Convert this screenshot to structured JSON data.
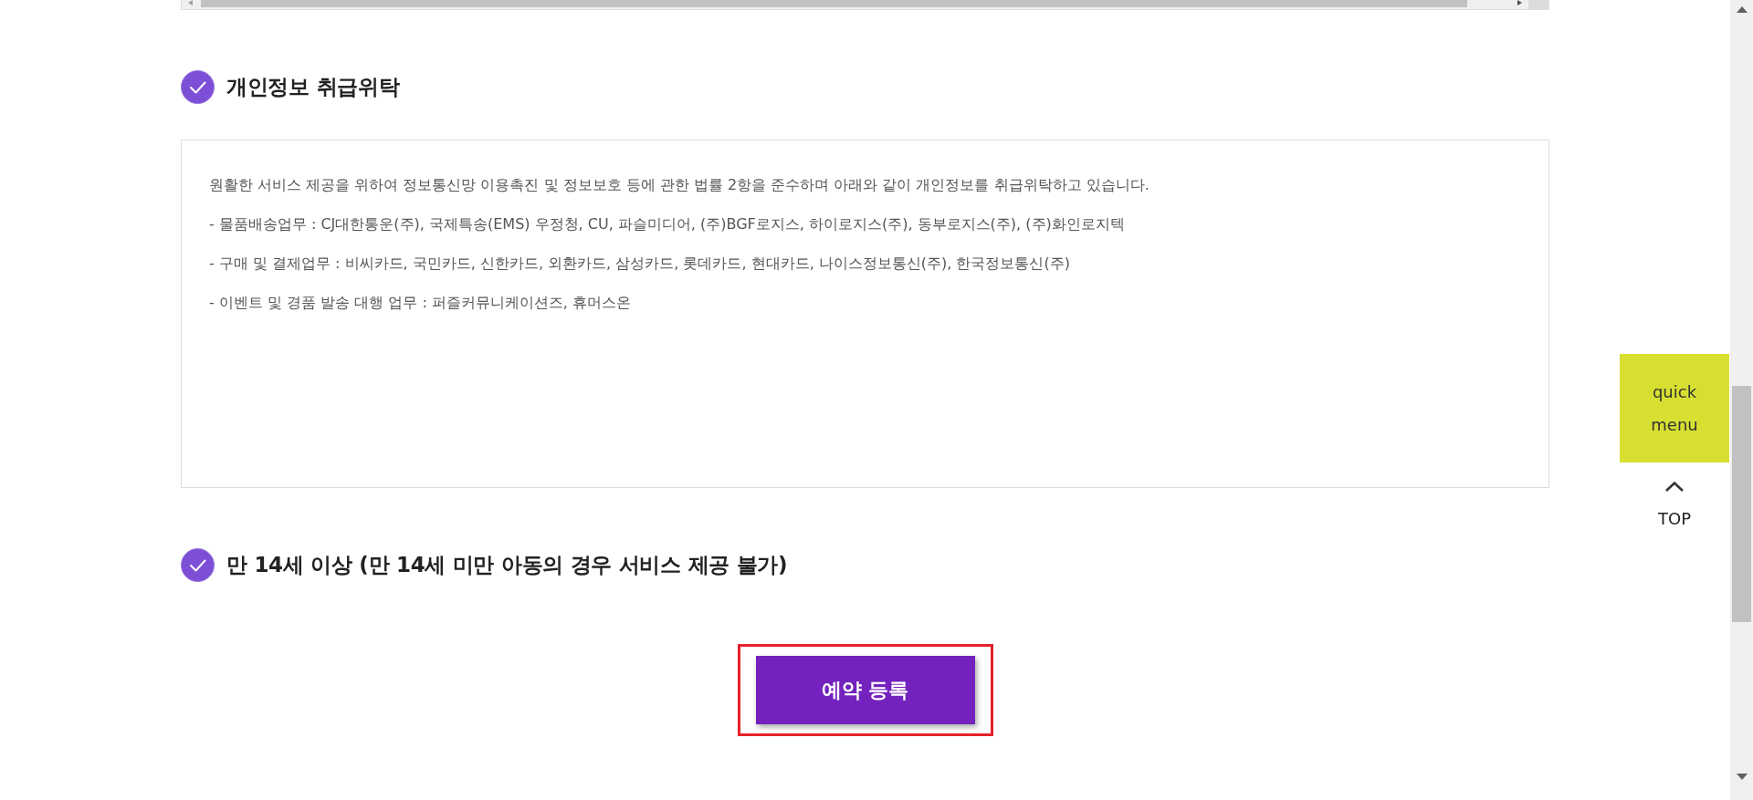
{
  "sections": [
    {
      "title": "개인정보 취급위탁",
      "checked": true,
      "content": [
        "원활한 서비스 제공을 위하여 정보통신망 이용촉진 및 정보보호 등에 관한 법률 2항을 준수하며 아래와 같이 개인정보를 취급위탁하고 있습니다.",
        "- 물품배송업무 : CJ대한통운(주), 국제특송(EMS) 우정청, CU, 파슬미디어,  (주)BGF로지스, 하이로지스(주), 동부로지스(주), (주)화인로지텍",
        "- 구매 및 결제업무 : 비씨카드, 국민카드, 신한카드, 외환카드, 삼성카드, 롯데카드, 현대카드, 나이스정보통신(주), 한국정보통신(주)",
        "- 이벤트 및 경품 발송 대행 업무 : 퍼즐커뮤니케이션즈, 휴머스온"
      ]
    },
    {
      "title": "만 14세 이상 (만 14세 미만 아동의 경우 서비스 제공 불가)",
      "checked": true
    }
  ],
  "submit_button": {
    "label": "예약 등록",
    "highlighted": true
  },
  "quick_menu": {
    "label": "quick menu"
  },
  "top_button": {
    "label": "TOP"
  }
}
